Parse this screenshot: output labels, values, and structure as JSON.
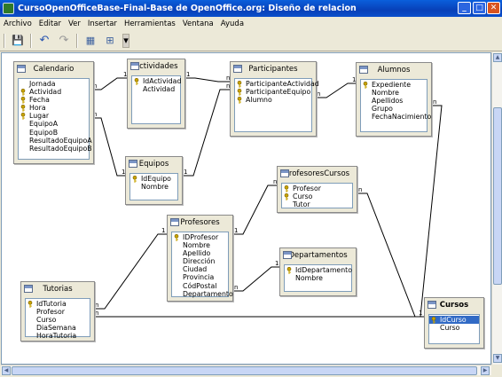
{
  "window": {
    "title": "CursoOpenOfficeBase-Final-Base de OpenOffice.org: Diseño de relacion",
    "min_label": "_",
    "max_label": "□",
    "close_label": "✕"
  },
  "menu": [
    "Archivo",
    "Editar",
    "Ver",
    "Insertar",
    "Herramientas",
    "Ventana",
    "Ayuda"
  ],
  "toolbar": {
    "icons": [
      "save-icon",
      "undo-icon",
      "redo-icon",
      "new-table-icon",
      "new-relation-icon",
      "toolbar-options-icon"
    ],
    "glyphs": {
      "save": "💾",
      "undo": "↶",
      "redo": "↷",
      "table": "▦",
      "relation": "⊞",
      "more": "▾"
    }
  },
  "key_color": "#c9a400",
  "selection_color": "#316ac5",
  "tables": {
    "calendario": {
      "title": "Calendario",
      "fields": [
        {
          "name": "Jornada",
          "key": false
        },
        {
          "name": "Actividad",
          "key": true
        },
        {
          "name": "Fecha",
          "key": true
        },
        {
          "name": "Hora",
          "key": true
        },
        {
          "name": "Lugar",
          "key": true
        },
        {
          "name": "EquipoA",
          "key": false
        },
        {
          "name": "EquipoB",
          "key": false
        },
        {
          "name": "ResultadoEquipoA",
          "key": false
        },
        {
          "name": "ResultadoEquipoB",
          "key": false
        }
      ]
    },
    "actividades": {
      "title": "Actividades",
      "fields": [
        {
          "name": "IdActividad",
          "key": true
        },
        {
          "name": "Actividad",
          "key": false
        }
      ]
    },
    "participantes": {
      "title": "Participantes",
      "fields": [
        {
          "name": "ParticipanteActividad",
          "key": true
        },
        {
          "name": "ParticipanteEquipo",
          "key": true
        },
        {
          "name": "Alumno",
          "key": true
        }
      ]
    },
    "alumnos": {
      "title": "Alumnos",
      "fields": [
        {
          "name": "Expediente",
          "key": true
        },
        {
          "name": "Nombre",
          "key": false
        },
        {
          "name": "Apellidos",
          "key": false
        },
        {
          "name": "Grupo",
          "key": false
        },
        {
          "name": "FechaNacimiento",
          "key": false
        }
      ]
    },
    "equipos": {
      "title": "Equipos",
      "fields": [
        {
          "name": "IdEquipo",
          "key": true
        },
        {
          "name": "Nombre",
          "key": false
        }
      ]
    },
    "profesorescursos": {
      "title": "ProfesoresCursos",
      "fields": [
        {
          "name": "Profesor",
          "key": true
        },
        {
          "name": "Curso",
          "key": true
        },
        {
          "name": "Tutor",
          "key": false
        }
      ]
    },
    "profesores": {
      "title": "Profesores",
      "fields": [
        {
          "name": "IDProfesor",
          "key": true
        },
        {
          "name": "Nombre",
          "key": false
        },
        {
          "name": "Apellido",
          "key": false
        },
        {
          "name": "Dirección",
          "key": false
        },
        {
          "name": "Ciudad",
          "key": false
        },
        {
          "name": "Provincia",
          "key": false
        },
        {
          "name": "CódPostal",
          "key": false
        },
        {
          "name": "Departamento",
          "key": false
        }
      ]
    },
    "departamentos": {
      "title": "Departamentos",
      "fields": [
        {
          "name": "IdDepartamento",
          "key": true
        },
        {
          "name": "Nombre",
          "key": false
        }
      ]
    },
    "tutorias": {
      "title": "Tutorias",
      "fields": [
        {
          "name": "IdTutoria",
          "key": true
        },
        {
          "name": "Profesor",
          "key": false
        },
        {
          "name": "Curso",
          "key": false
        },
        {
          "name": "DiaSemana",
          "key": false
        },
        {
          "name": "HoraTutoria",
          "key": false
        }
      ]
    },
    "cursos": {
      "title": "Cursos",
      "fields": [
        {
          "name": "IdCurso",
          "key": true,
          "selected": true
        },
        {
          "name": "Curso",
          "key": false
        }
      ]
    }
  },
  "relations": [
    {
      "from": "calendario.Actividad",
      "to": "actividades.IdActividad",
      "from_card": "n",
      "to_card": "1"
    },
    {
      "from": "calendario.EquipoA",
      "to": "equipos.IdEquipo",
      "from_card": "n",
      "to_card": "1"
    },
    {
      "from": "actividades.IdActividad",
      "to": "participantes.ParticipanteActividad",
      "from_card": "1",
      "to_card": "n"
    },
    {
      "from": "equipos.IdEquipo",
      "to": "participantes.ParticipanteEquipo",
      "from_card": "1",
      "to_card": "n"
    },
    {
      "from": "alumnos.Expediente",
      "to": "participantes.Alumno",
      "from_card": "1",
      "to_card": "n"
    },
    {
      "from": "profesores.IDProfesor",
      "to": "profesorescursos.Profesor",
      "from_card": "1",
      "to_card": "n"
    },
    {
      "from": "departamentos.IdDepartamento",
      "to": "profesores.Departamento",
      "from_card": "1",
      "to_card": "n"
    },
    {
      "from": "profesores.IDProfesor",
      "to": "tutorias.Profesor",
      "from_card": "1",
      "to_card": "n"
    },
    {
      "from": "cursos.IdCurso",
      "to": "profesorescursos.Curso",
      "from_card": "1",
      "to_card": "n"
    },
    {
      "from": "cursos.IdCurso",
      "to": "tutorias.Curso",
      "from_card": "1",
      "to_card": "n"
    },
    {
      "from": "alumnos.Grupo",
      "to": "cursos.IdCurso",
      "from_card": "n",
      "to_card": "1"
    }
  ]
}
